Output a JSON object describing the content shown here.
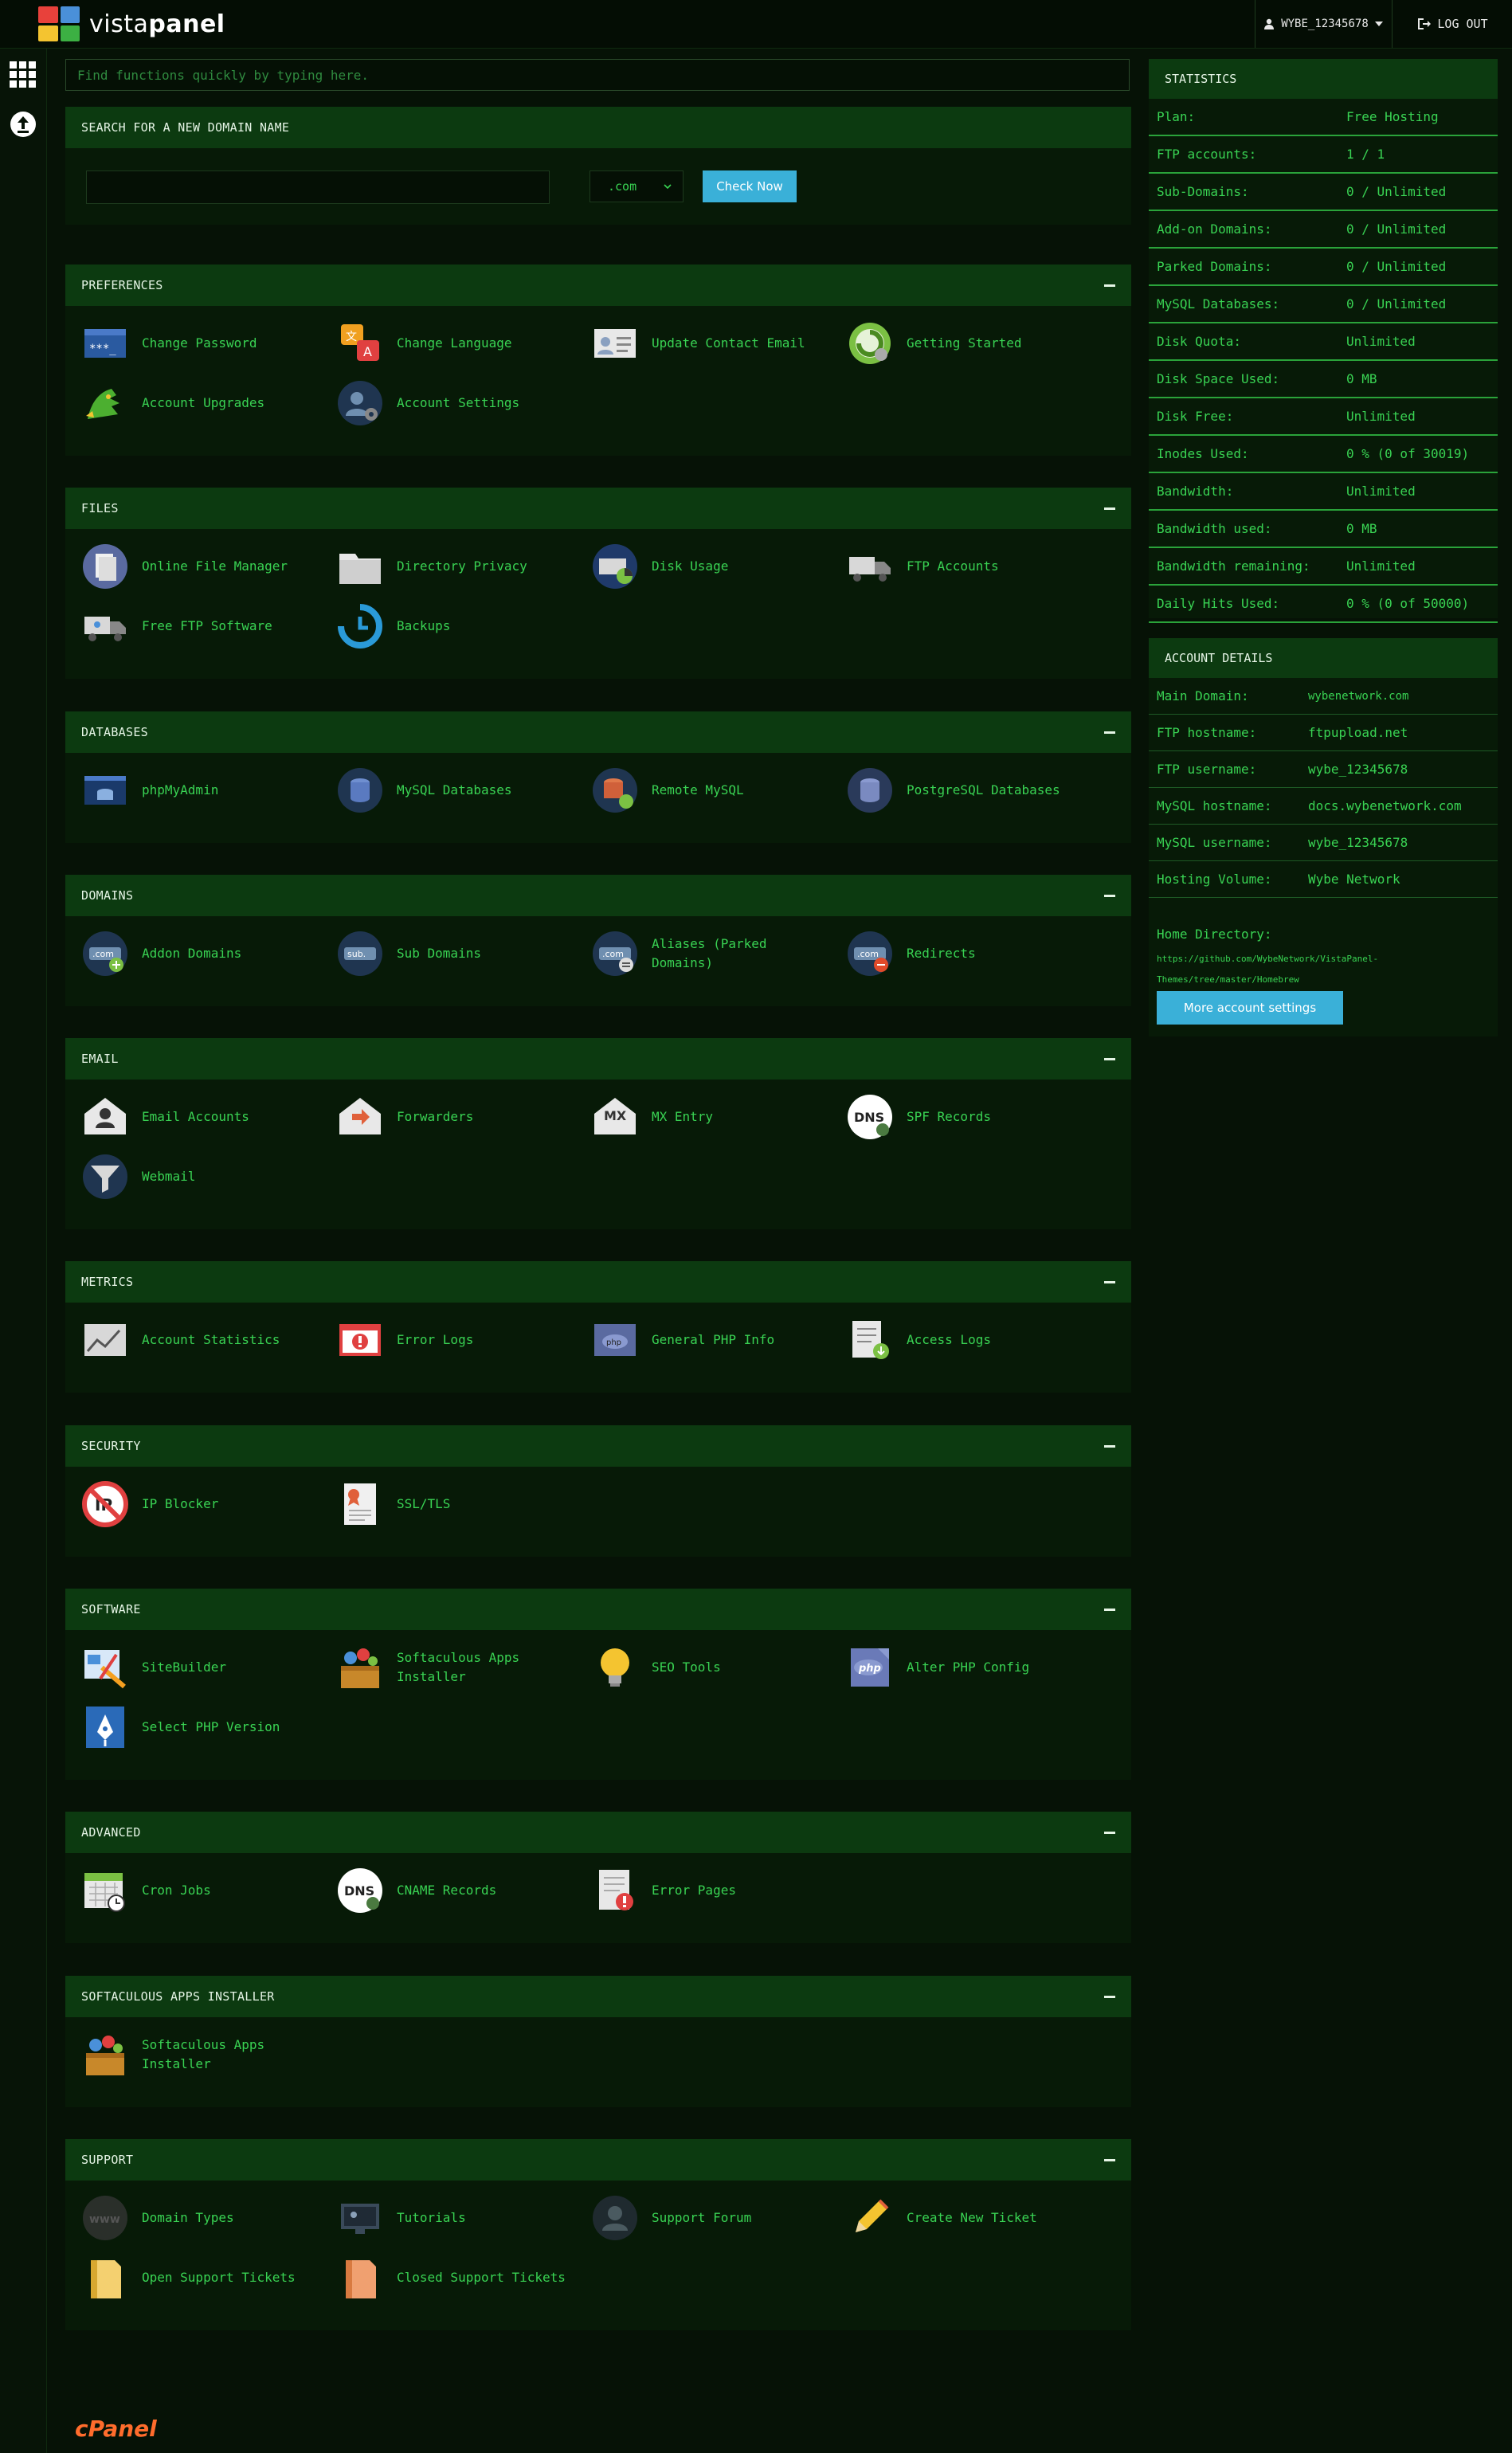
{
  "brand": {
    "logo_text_light": "vista",
    "logo_text_bold": "panel",
    "logo_colors": [
      "#e8413b",
      "#4a90d9",
      "#f4c430",
      "#3cb043"
    ]
  },
  "topbar": {
    "username": "WYBE_12345678",
    "logout_label": "LOG OUT"
  },
  "quick_search": {
    "placeholder": "Find functions quickly by typing here."
  },
  "domain_search": {
    "title": "SEARCH FOR A NEW DOMAIN NAME",
    "tld": ".com",
    "button": "Check Now"
  },
  "panels": [
    {
      "title": "PREFERENCES",
      "items": [
        {
          "label": "Change Password",
          "icon": "password-icon"
        },
        {
          "label": "Change Language",
          "icon": "language-icon"
        },
        {
          "label": "Update Contact Email",
          "icon": "contact-card-icon"
        },
        {
          "label": "Getting Started",
          "icon": "getting-started-icon"
        },
        {
          "label": "Account Upgrades",
          "icon": "dragon-icon"
        },
        {
          "label": "Account Settings",
          "icon": "user-settings-icon"
        }
      ]
    },
    {
      "title": "FILES",
      "items": [
        {
          "label": "Online File Manager",
          "icon": "file-manager-icon"
        },
        {
          "label": "Directory Privacy",
          "icon": "folder-icon"
        },
        {
          "label": "Disk Usage",
          "icon": "disk-usage-icon"
        },
        {
          "label": "FTP Accounts",
          "icon": "ftp-truck-icon"
        },
        {
          "label": "Free FTP Software",
          "icon": "ftp-software-icon"
        },
        {
          "label": "Backups",
          "icon": "backup-icon"
        }
      ]
    },
    {
      "title": "DATABASES",
      "items": [
        {
          "label": "phpMyAdmin",
          "icon": "phpmyadmin-icon"
        },
        {
          "label": "MySQL Databases",
          "icon": "database-icon"
        },
        {
          "label": "Remote MySQL",
          "icon": "remote-database-icon"
        },
        {
          "label": "PostgreSQL Databases",
          "icon": "postgres-database-icon"
        }
      ]
    },
    {
      "title": "DOMAINS",
      "items": [
        {
          "label": "Addon Domains",
          "icon": "addon-domain-icon"
        },
        {
          "label": "Sub Domains",
          "icon": "subdomain-icon"
        },
        {
          "label": "Aliases (Parked Domains)",
          "icon": "alias-domain-icon"
        },
        {
          "label": "Redirects",
          "icon": "redirect-domain-icon"
        }
      ]
    },
    {
      "title": "EMAIL",
      "items": [
        {
          "label": "Email Accounts",
          "icon": "email-account-icon"
        },
        {
          "label": "Forwarders",
          "icon": "forwarder-icon"
        },
        {
          "label": "MX Entry",
          "icon": "mx-entry-icon"
        },
        {
          "label": "SPF Records",
          "icon": "dns-icon"
        },
        {
          "label": "Webmail",
          "icon": "webmail-funnel-icon"
        }
      ]
    },
    {
      "title": "METRICS",
      "items": [
        {
          "label": "Account Statistics",
          "icon": "statistics-chart-icon"
        },
        {
          "label": "Error Logs",
          "icon": "error-log-icon"
        },
        {
          "label": "General PHP Info",
          "icon": "php-info-icon"
        },
        {
          "label": "Access Logs",
          "icon": "access-log-icon"
        }
      ]
    },
    {
      "title": "SECURITY",
      "items": [
        {
          "label": "IP Blocker",
          "icon": "ip-blocker-icon"
        },
        {
          "label": "SSL/TLS",
          "icon": "certificate-icon"
        }
      ]
    },
    {
      "title": "SOFTWARE",
      "items": [
        {
          "label": "SiteBuilder",
          "icon": "sitebuilder-icon"
        },
        {
          "label": "Softaculous Apps Installer",
          "icon": "softaculous-icon"
        },
        {
          "label": "SEO Tools",
          "icon": "lightbulb-icon"
        },
        {
          "label": "Alter PHP Config",
          "icon": "php-config-icon"
        },
        {
          "label": "Select PHP Version",
          "icon": "php-version-icon"
        }
      ]
    },
    {
      "title": "ADVANCED",
      "items": [
        {
          "label": "Cron Jobs",
          "icon": "cron-calendar-icon"
        },
        {
          "label": "CNAME Records",
          "icon": "dns-icon"
        },
        {
          "label": "Error Pages",
          "icon": "error-page-icon"
        }
      ]
    },
    {
      "title": "SOFTACULOUS APPS INSTALLER",
      "items": [
        {
          "label": "Softaculous Apps Installer",
          "icon": "softaculous-icon"
        }
      ]
    },
    {
      "title": "SUPPORT",
      "items": [
        {
          "label": "Domain Types",
          "icon": "www-icon"
        },
        {
          "label": "Tutorials",
          "icon": "tutorials-icon"
        },
        {
          "label": "Support Forum",
          "icon": "support-forum-icon"
        },
        {
          "label": "Create New Ticket",
          "icon": "pencil-icon"
        },
        {
          "label": "Open Support Tickets",
          "icon": "open-ticket-icon"
        },
        {
          "label": "Closed Support Tickets",
          "icon": "closed-ticket-icon"
        }
      ]
    }
  ],
  "statistics": {
    "title": "STATISTICS",
    "rows": [
      {
        "k": "Plan:",
        "v": "Free Hosting"
      },
      {
        "k": "FTP accounts:",
        "v": "1 / 1"
      },
      {
        "k": "Sub-Domains:",
        "v": "0 / Unlimited"
      },
      {
        "k": "Add-on Domains:",
        "v": "0 / Unlimited"
      },
      {
        "k": "Parked Domains:",
        "v": "0 / Unlimited"
      },
      {
        "k": "MySQL Databases:",
        "v": "0 / Unlimited"
      },
      {
        "k": "Disk Quota:",
        "v": "Unlimited"
      },
      {
        "k": "Disk Space Used:",
        "v": "0 MB"
      },
      {
        "k": "Disk Free:",
        "v": "Unlimited"
      },
      {
        "k": "Inodes Used:",
        "v": "0 % (0 of 30019)"
      },
      {
        "k": "Bandwidth:",
        "v": "Unlimited"
      },
      {
        "k": "Bandwidth used:",
        "v": "0 MB"
      },
      {
        "k": "Bandwidth remaining:",
        "v": "Unlimited"
      },
      {
        "k": "Daily Hits Used:",
        "v": "0 % (0 of 50000)"
      }
    ]
  },
  "account_details": {
    "title": "ACCOUNT DETAILS",
    "rows": [
      {
        "k": "Main Domain:",
        "v": "wybenetwork.com"
      },
      {
        "k": "FTP hostname:",
        "v": "ftpupload.net"
      },
      {
        "k": "FTP username:",
        "v": "wybe_12345678"
      },
      {
        "k": "MySQL hostname:",
        "v": "docs.wybenetwork.com"
      },
      {
        "k": "MySQL username:",
        "v": "wybe_12345678"
      },
      {
        "k": "Hosting Volume:",
        "v": "Wybe Network"
      }
    ],
    "home_label": "Home Directory:",
    "home_value": "https://github.com/WybeNetwork/VistaPanel-Themes/tree/master/Homebrew",
    "more_button": "More account settings"
  },
  "footer": {
    "brand": "cPanel"
  },
  "colors": {
    "bg": "#061206",
    "panel": "#071a07",
    "header": "#0c3a10",
    "text": "#39d353",
    "accent": "#3ab0d8"
  }
}
